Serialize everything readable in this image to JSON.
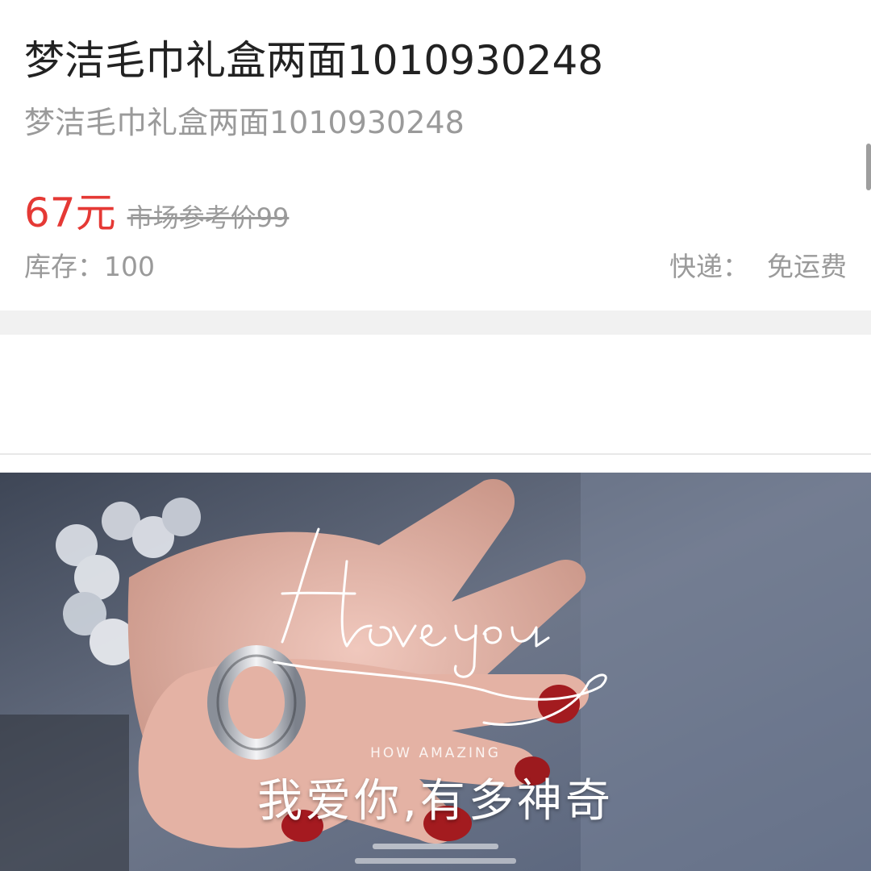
{
  "product": {
    "title": "梦洁毛巾礼盒两面1010930248",
    "subtitle": "梦洁毛巾礼盒两面1010930248",
    "price": "67元",
    "market_price": "市场参考价99",
    "stock_label": "库存：",
    "stock_value": "100",
    "shipping_label": "快递：",
    "shipping_value": "免运费"
  },
  "banner": {
    "script_text": "I love you",
    "title_en": "HOW AMAZING",
    "title_cn": "我爱你,有多神奇"
  },
  "colors": {
    "price_red": "#e53935",
    "text_dark": "#222222",
    "text_gray": "#9a9a9a",
    "divider": "#f1f1f1"
  }
}
